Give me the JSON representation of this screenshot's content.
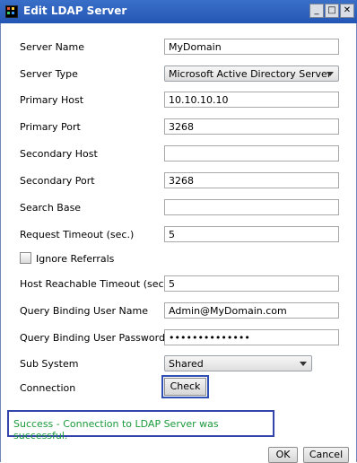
{
  "window": {
    "title": "Edit LDAP Server",
    "minimize_glyph": "_",
    "maximize_glyph": "□",
    "close_glyph": "✕"
  },
  "form": {
    "server_name": {
      "label": "Server Name",
      "value": "MyDomain"
    },
    "server_type": {
      "label": "Server Type",
      "value": "Microsoft Active Directory Server"
    },
    "primary_host": {
      "label": "Primary Host",
      "value": "10.10.10.10"
    },
    "primary_port": {
      "label": "Primary Port",
      "value": "3268"
    },
    "secondary_host": {
      "label": "Secondary Host",
      "value": ""
    },
    "secondary_port": {
      "label": "Secondary Port",
      "value": "3268"
    },
    "search_base": {
      "label": "Search Base",
      "value": ""
    },
    "request_timeout": {
      "label": "Request Timeout (sec.)",
      "value": "5"
    },
    "ignore_referrals": {
      "label": "Ignore Referrals",
      "checked": false
    },
    "host_reachable_timeout": {
      "label": "Host Reachable Timeout (sec.)",
      "value": "5"
    },
    "query_binding_user_name": {
      "label": "Query Binding User Name",
      "value": "Admin@MyDomain.com"
    },
    "query_binding_user_password": {
      "label": "Query Binding User Password",
      "value": "••••••••••••••"
    },
    "sub_system": {
      "label": "Sub System",
      "value": "Shared"
    },
    "connection": {
      "label": "Connection",
      "button": "Check"
    }
  },
  "status": {
    "message": "Success - Connection to LDAP Server was successful.",
    "color": "#1a9a3a"
  },
  "footer": {
    "ok": "OK",
    "cancel": "Cancel"
  },
  "colors": {
    "titlebar": "#2f63c0",
    "highlight_border": "#2f4fb5"
  }
}
